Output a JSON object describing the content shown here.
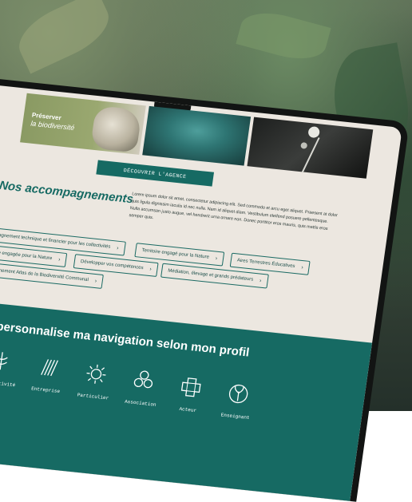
{
  "hero_tile": {
    "label_bold": "Préserver",
    "label_italic": "la biodiversité"
  },
  "cta_label": "DÉCOUVRIR L'AGENCE",
  "section": {
    "title": "Nos accompagnements",
    "body": "Lorem ipsum dolor sit amet, consectetur adipiscing elit. Sed commodo et arcu eget aliquet. Praesent at dolor quis ligula dignissim iaculis id nec nulla. Nam id aliquet diam. Vestibulum eleifend posuere pellentesque. Nulla accumsan justo augue, vel hendrerit urna ornare non. Donec porttitor eros mauris, quis mattis eros semper quis."
  },
  "chips": [
    "Accompagnement technique et financier pour les collectivités",
    "Territoire engagé pour la Nature",
    "Aires Terrestres Éducatives",
    "Entreprise engagée pour la Nature",
    "Développer vos compétences",
    "Médiation, élevage et grands prédateurs",
    "Accompagnement Atlas de la Biodiversité Communal"
  ],
  "profile": {
    "title": "Je personnalise ma navigation selon mon profil",
    "items": [
      "Collectivité",
      "Entreprise",
      "Particulier",
      "Association",
      "Acteur",
      "Enseignant"
    ]
  },
  "colors": {
    "brand": "#166a63",
    "screen_bg": "#ece7e0"
  },
  "icons": [
    "collectivite-icon",
    "entreprise-icon",
    "particulier-icon",
    "association-icon",
    "acteur-icon",
    "enseignant-icon"
  ]
}
